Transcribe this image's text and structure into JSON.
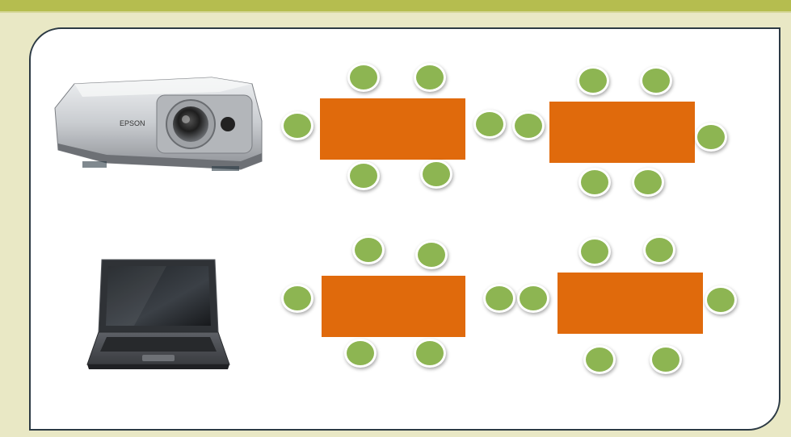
{
  "colors": {
    "background": "#e9e8c5",
    "top_band": "#b5bd4f",
    "frame_border": "#2c3a44",
    "table_fill": "#e06a0c",
    "chair_fill": "#8db552"
  },
  "devices": [
    {
      "name": "projector-icon",
      "label": "EPSON"
    },
    {
      "name": "laptop-icon",
      "label": ""
    }
  ],
  "tables": [
    {
      "id": "table-top-left",
      "chairs": 6
    },
    {
      "id": "table-top-right",
      "chairs": 6
    },
    {
      "id": "table-bottom-left",
      "chairs": 6
    },
    {
      "id": "table-bottom-right",
      "chairs": 6
    }
  ]
}
